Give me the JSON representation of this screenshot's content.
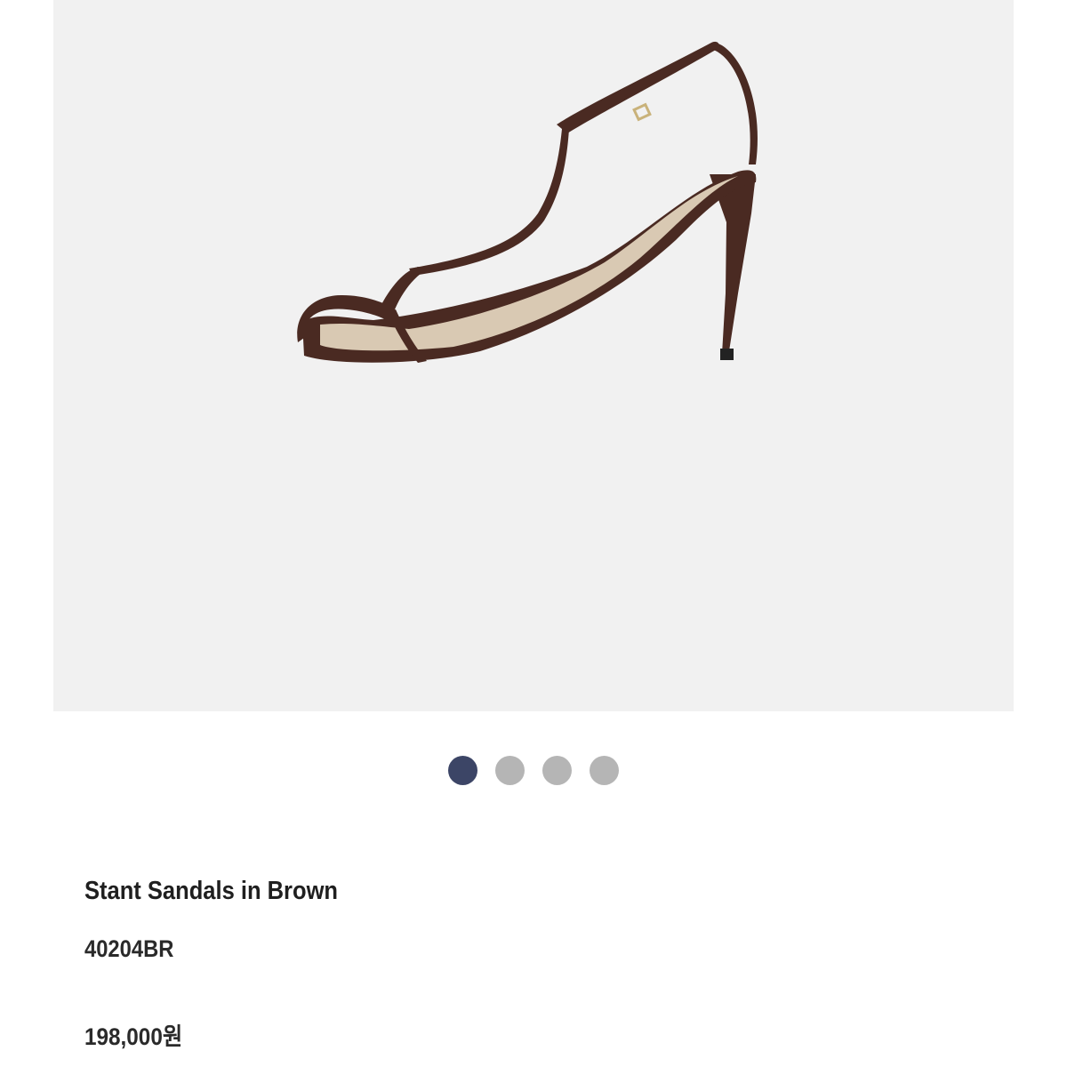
{
  "gallery": {
    "image_subject": "brown strappy high-heel sandal",
    "colors": {
      "background": "#f1f1f1",
      "strap": "#4a2a22",
      "insole": "#d9c9b3",
      "buckle": "#c9b27a"
    },
    "pager": {
      "active_index": 0,
      "count": 4,
      "active_color": "#3c4566",
      "inactive_color": "#b5b5b5"
    }
  },
  "product": {
    "name": "Stant Sandals in Brown",
    "code": "40204BR",
    "price": "198,000원"
  }
}
